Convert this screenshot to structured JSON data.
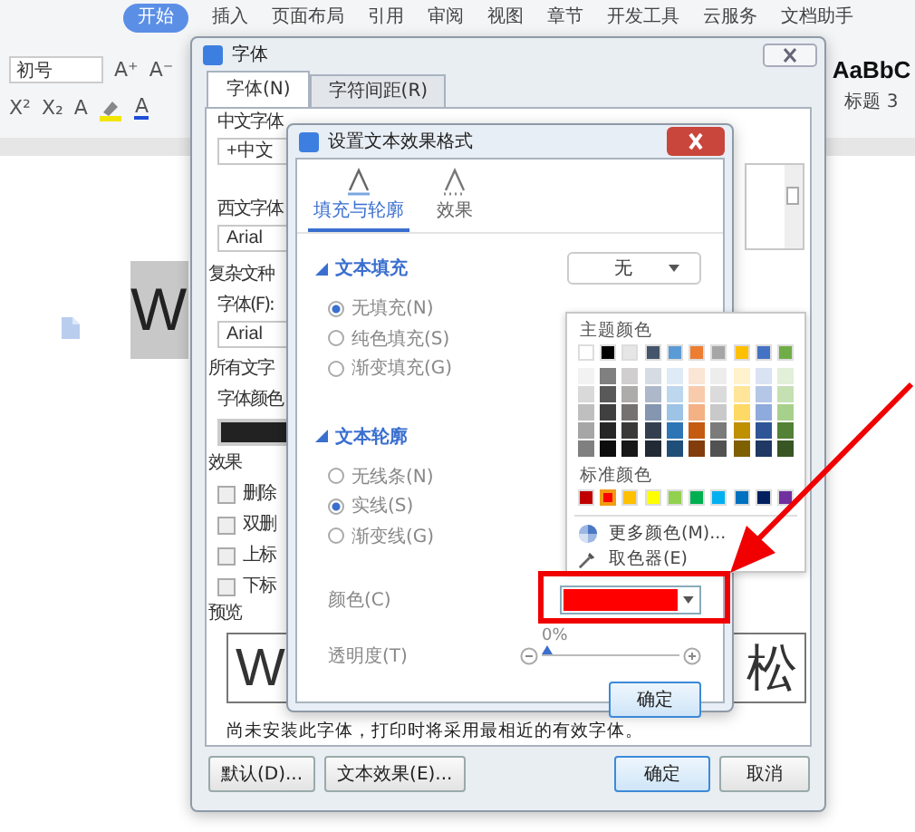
{
  "ribbon": {
    "tabs": [
      {
        "label": "开始",
        "selected": true
      },
      {
        "label": "插入",
        "selected": false
      },
      {
        "label": "页面布局",
        "selected": false
      },
      {
        "label": "引用",
        "selected": false
      },
      {
        "label": "审阅",
        "selected": false
      },
      {
        "label": "视图",
        "selected": false
      },
      {
        "label": "章节",
        "selected": false
      },
      {
        "label": "开发工具",
        "selected": false
      },
      {
        "label": "云服务",
        "selected": false
      },
      {
        "label": "文档助手",
        "selected": false
      }
    ],
    "font_size": "初号",
    "size_buttons": [
      "A⁺",
      "A⁻"
    ],
    "script_buttons": [
      "X²",
      "X₂"
    ],
    "effect_button": "A",
    "color_button": "A",
    "style_preview": "AaBbC",
    "style_name": "标题 3"
  },
  "document": {
    "selected_text": "W"
  },
  "font_dialog": {
    "title": "字体",
    "tabs": [
      {
        "label": "字体(N)",
        "selected": true
      },
      {
        "label": "字符间距(R)",
        "selected": false
      }
    ],
    "chinese_font_label": "中文字体",
    "chinese_font": "+中文",
    "western_font_label": "西文字体",
    "western_font": "Arial",
    "complex_label": "复杂文种",
    "complex_font_label": "字体(F):",
    "complex_font": "Arial",
    "all_text_label": "所有文字",
    "font_color_label": "字体颜色",
    "effects_label": "效果",
    "effects": [
      {
        "label": "删除",
        "checked": false
      },
      {
        "label": "双删",
        "checked": false
      },
      {
        "label": "上标",
        "checked": false
      },
      {
        "label": "下标",
        "checked": false
      }
    ],
    "preview_label": "预览",
    "preview_latin": "W",
    "preview_cjk": "松",
    "note": "尚未安装此字体，打印时将采用最相近的有效字体。",
    "buttons": [
      {
        "label": "默认(D)...",
        "kind": "left"
      },
      {
        "label": "文本效果(E)...",
        "kind": "left"
      },
      {
        "label": "确定",
        "kind": "default"
      },
      {
        "label": "取消",
        "kind": "right"
      }
    ]
  },
  "effect_dialog": {
    "title": "设置文本效果格式",
    "tabs": [
      {
        "label": "填充与轮廓",
        "selected": true
      },
      {
        "label": "效果",
        "selected": false
      }
    ],
    "fill": {
      "header": "文本填充",
      "dropdown": "无",
      "options": [
        {
          "label": "无填充(N)",
          "selected": true
        },
        {
          "label": "纯色填充(S)",
          "selected": false
        },
        {
          "label": "渐变填充(G)",
          "selected": false
        }
      ]
    },
    "outline": {
      "header": "文本轮廓",
      "options": [
        {
          "label": "无线条(N)",
          "selected": false
        },
        {
          "label": "实线(S)",
          "selected": true
        },
        {
          "label": "渐变线(G)",
          "selected": false
        }
      ],
      "color_label": "颜色(C)",
      "color": "#ff0000",
      "transparency_label": "透明度(T)",
      "level": 0,
      "reading": "0%"
    },
    "ok": "确定"
  },
  "color_popup": {
    "theme_label": "主题颜色",
    "theme": [
      {
        "color": "#ffffff",
        "shades": [
          {
            "color": "#f2f2f2"
          },
          {
            "color": "#d9d9d9"
          },
          {
            "color": "#bfbfbf"
          },
          {
            "color": "#a6a6a6"
          },
          {
            "color": "#808080"
          }
        ]
      },
      {
        "color": "#000000",
        "shades": [
          {
            "color": "#808080"
          },
          {
            "color": "#595959"
          },
          {
            "color": "#404040"
          },
          {
            "color": "#262626"
          },
          {
            "color": "#0d0d0d"
          }
        ]
      },
      {
        "color": "#e7e6e6",
        "shades": [
          {
            "color": "#d0cece"
          },
          {
            "color": "#aeabab"
          },
          {
            "color": "#767171"
          },
          {
            "color": "#3b3838"
          },
          {
            "color": "#181717"
          }
        ]
      },
      {
        "color": "#44546a",
        "shades": [
          {
            "color": "#d6dce4"
          },
          {
            "color": "#adb9ca"
          },
          {
            "color": "#8496b0"
          },
          {
            "color": "#333f4f"
          },
          {
            "color": "#222a35"
          }
        ]
      },
      {
        "color": "#5b9bd5",
        "shades": [
          {
            "color": "#deebf6"
          },
          {
            "color": "#bdd7ee"
          },
          {
            "color": "#9dc3e6"
          },
          {
            "color": "#2e75b5"
          },
          {
            "color": "#1f4e79"
          }
        ]
      },
      {
        "color": "#ed7d31",
        "shades": [
          {
            "color": "#fbe5d5"
          },
          {
            "color": "#f7cbac"
          },
          {
            "color": "#f4b183"
          },
          {
            "color": "#c55a11"
          },
          {
            "color": "#833c0b"
          }
        ]
      },
      {
        "color": "#a5a5a5",
        "shades": [
          {
            "color": "#ededed"
          },
          {
            "color": "#dbdbdb"
          },
          {
            "color": "#c9c9c9"
          },
          {
            "color": "#7b7b7b"
          },
          {
            "color": "#525252"
          }
        ]
      },
      {
        "color": "#ffc000",
        "shades": [
          {
            "color": "#fff2cc"
          },
          {
            "color": "#fee599"
          },
          {
            "color": "#ffd965"
          },
          {
            "color": "#bf9000"
          },
          {
            "color": "#7f6000"
          }
        ]
      },
      {
        "color": "#4472c4",
        "shades": [
          {
            "color": "#dae3f3"
          },
          {
            "color": "#b4c7e7"
          },
          {
            "color": "#8faadc"
          },
          {
            "color": "#2f5597"
          },
          {
            "color": "#1f3864"
          }
        ]
      },
      {
        "color": "#70ad47",
        "shades": [
          {
            "color": "#e2efd9"
          },
          {
            "color": "#c5e0b3"
          },
          {
            "color": "#a8d08d"
          },
          {
            "color": "#538135"
          },
          {
            "color": "#375623"
          }
        ]
      }
    ],
    "standard_label": "标准颜色",
    "standard": [
      {
        "color": "#c00000",
        "selected": false
      },
      {
        "color": "#ff0000",
        "selected": true
      },
      {
        "color": "#ffc000",
        "selected": false
      },
      {
        "color": "#ffff00",
        "selected": false
      },
      {
        "color": "#92d050",
        "selected": false
      },
      {
        "color": "#00b050",
        "selected": false
      },
      {
        "color": "#00b0f0",
        "selected": false
      },
      {
        "color": "#0070c0",
        "selected": false
      },
      {
        "color": "#002060",
        "selected": false
      },
      {
        "color": "#7030a0",
        "selected": false
      }
    ],
    "more_colors": "更多颜色(M)...",
    "eyedropper": "取色器(E)"
  }
}
